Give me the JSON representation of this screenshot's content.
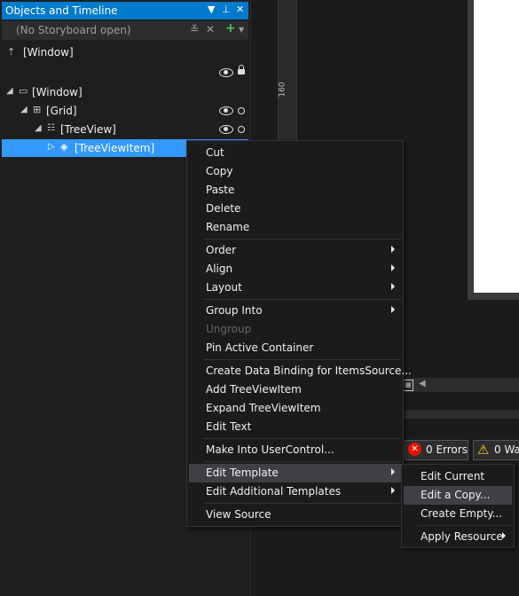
{
  "panel": {
    "title": "Objects and Timeline",
    "storyboard": "(No Storyboard open)",
    "root_label": "[Window]",
    "tree": [
      {
        "label": "[Window]"
      },
      {
        "label": "[Grid]"
      },
      {
        "label": "[TreeView]"
      },
      {
        "label": "[TreeViewItem]"
      }
    ]
  },
  "ruler": {
    "label": "160"
  },
  "status": {
    "errors": "0 Errors",
    "warnings": "0 Wa"
  },
  "context_menu": {
    "items": [
      {
        "label": "Cut"
      },
      {
        "label": "Copy"
      },
      {
        "label": "Paste"
      },
      {
        "label": "Delete"
      },
      {
        "label": "Rename"
      },
      {
        "label": "Order"
      },
      {
        "label": "Align"
      },
      {
        "label": "Layout"
      },
      {
        "label": "Group Into"
      },
      {
        "label": "Ungroup"
      },
      {
        "label": "Pin Active Container"
      },
      {
        "label": "Create Data Binding for ItemsSource..."
      },
      {
        "label": "Add TreeViewItem"
      },
      {
        "label": "Expand TreeViewItem"
      },
      {
        "label": "Edit Text"
      },
      {
        "label": "Make Into UserControl..."
      },
      {
        "label": "Edit Template"
      },
      {
        "label": "Edit Additional Templates"
      },
      {
        "label": "View Source"
      }
    ]
  },
  "submenu": {
    "items": [
      {
        "label": "Edit Current"
      },
      {
        "label": "Edit a Copy..."
      },
      {
        "label": "Create Empty..."
      },
      {
        "label": "Apply Resource"
      }
    ]
  }
}
